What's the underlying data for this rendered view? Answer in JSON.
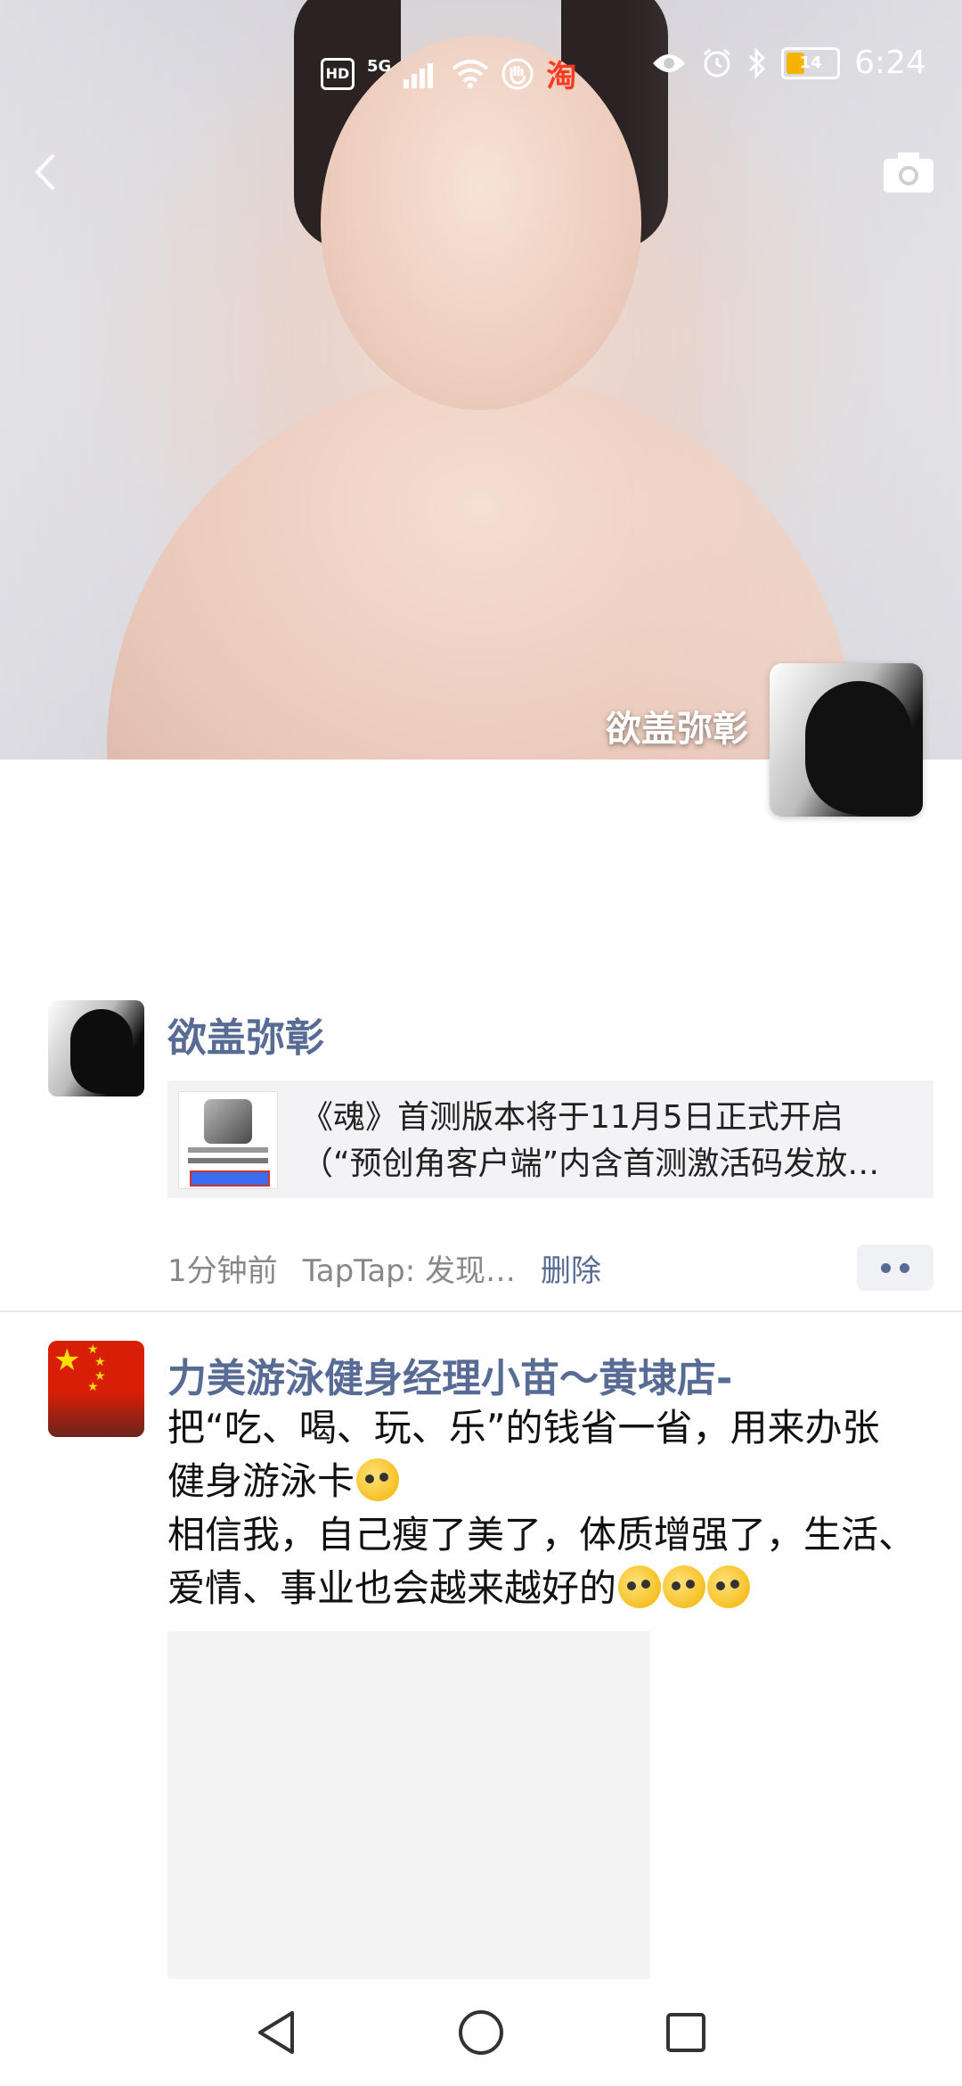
{
  "status_bar": {
    "hd": "HD",
    "network": "5G",
    "taobao_icon": "淘",
    "battery": "14",
    "time": "6:24",
    "icons": [
      "hd-icon",
      "signal-icon",
      "wifi-icon",
      "hand-icon",
      "taobao-icon",
      "eye-icon",
      "alarm-icon",
      "bluetooth-icon",
      "battery-icon"
    ]
  },
  "nav": {
    "back_icon": "chevron-left-icon",
    "camera_icon": "camera-icon"
  },
  "cover": {
    "name": "欲盖弥彰"
  },
  "posts": [
    {
      "username": "欲盖弥彰",
      "share": {
        "line1": "《魂》首测版本将于11月5日正式开启",
        "line2": "（“预创角客户端”内含首测激活码发放…"
      },
      "time": "1分钟前",
      "source": "TapTap: 发现…",
      "delete": "删除"
    },
    {
      "username": "力美游泳健身经理小苗～黄埭店-",
      "text_line1": "把“吃、喝、玩、乐”的钱省一省，用来办张健身游泳卡",
      "text_line2": "相信我，自己瘦了美了，体质增强了，生活、爱情、事业也会越来越好的"
    }
  ],
  "navbar": {
    "icons": [
      "nav-back-icon",
      "nav-home-icon",
      "nav-recents-icon"
    ]
  }
}
